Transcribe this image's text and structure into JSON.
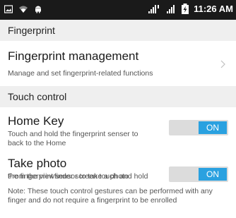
{
  "status_bar": {
    "time": "11:26 AM",
    "left_icons": [
      "gallery-icon",
      "wifi-icon",
      "android-icon"
    ],
    "right_icons": [
      "signal-icon",
      "signal-icon-2",
      "battery-charging-icon"
    ]
  },
  "sections": {
    "fingerprint": {
      "header": "Fingerprint"
    },
    "touch_control": {
      "header": "Touch control"
    }
  },
  "items": {
    "fingerprint_management": {
      "title": "Fingerprint management",
      "subtitle": "Manage and set fingerprint-related functions"
    },
    "home_key": {
      "title": "Home Key",
      "subtitle_line1": "Touch and hold the fingerprint senser to",
      "subtitle_line2": "back to the Home",
      "toggle": "ON"
    },
    "take_photo": {
      "title": "Take photo",
      "subtitle_line1": "From the viewfinder screen touch and hold",
      "subtitle_line2": "the fingerprint sensor to take a photo",
      "toggle": "ON"
    }
  },
  "note": {
    "line1": "Note: These touch control gestures can be performed with any",
    "line2": "finger and do not require a fingerprint to be enrolled"
  },
  "colors": {
    "accent": "#2aa1e0",
    "status_bar": "#1a1a1a",
    "section_bg": "#efefef"
  }
}
